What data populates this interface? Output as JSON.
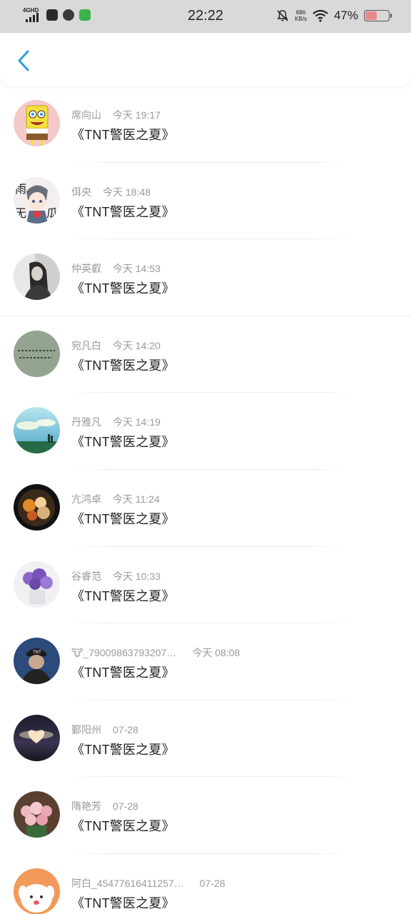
{
  "status_bar": {
    "network": "4GHD",
    "time": "22:22",
    "speed_value": "686",
    "speed_unit": "KB/s",
    "battery_percent": "47%",
    "battery_level": 0.47
  },
  "nav": {
    "back_icon": "chevron-left-icon",
    "accent": "#2f9be0"
  },
  "list": [
    {
      "name": "席向山",
      "time": "今天 19:17",
      "title": "《TNT警医之夏》",
      "avatar": "spongebob"
    },
    {
      "name": "佴央",
      "time": "今天 18:48",
      "title": "《TNT警医之夏》",
      "avatar": "anime-boy"
    },
    {
      "name": "仲英叡",
      "time": "今天 14:53",
      "title": "《TNT警医之夏》",
      "avatar": "girl-bw"
    },
    {
      "name": "宛凡白",
      "time": "今天 14:20",
      "title": "《TNT警医之夏》",
      "avatar": "green-text"
    },
    {
      "name": "丹雅凡",
      "time": "今天 14:19",
      "title": "《TNT警医之夏》",
      "avatar": "sky-scene"
    },
    {
      "name": "亢鸿卓",
      "time": "今天 11:24",
      "title": "《TNT警医之夏》",
      "avatar": "food"
    },
    {
      "name": "谷睿范",
      "time": "今天 10:33",
      "title": "《TNT警医之夏》",
      "avatar": "flowers-purple"
    },
    {
      "name": "🐮_79009863793207…",
      "time": "今天 08:08",
      "title": "《TNT警医之夏》",
      "avatar": "person-cap"
    },
    {
      "name": "鄞阳州",
      "time": "07-28",
      "title": "《TNT警医之夏》",
      "avatar": "heart-sky"
    },
    {
      "name": "隋艳芳",
      "time": "07-28",
      "title": "《TNT警医之夏》",
      "avatar": "flowers-pink"
    },
    {
      "name": "阿白_45477616411257…",
      "time": "07-28",
      "title": "《TNT警医之夏》",
      "avatar": "cartoon-dog"
    }
  ]
}
